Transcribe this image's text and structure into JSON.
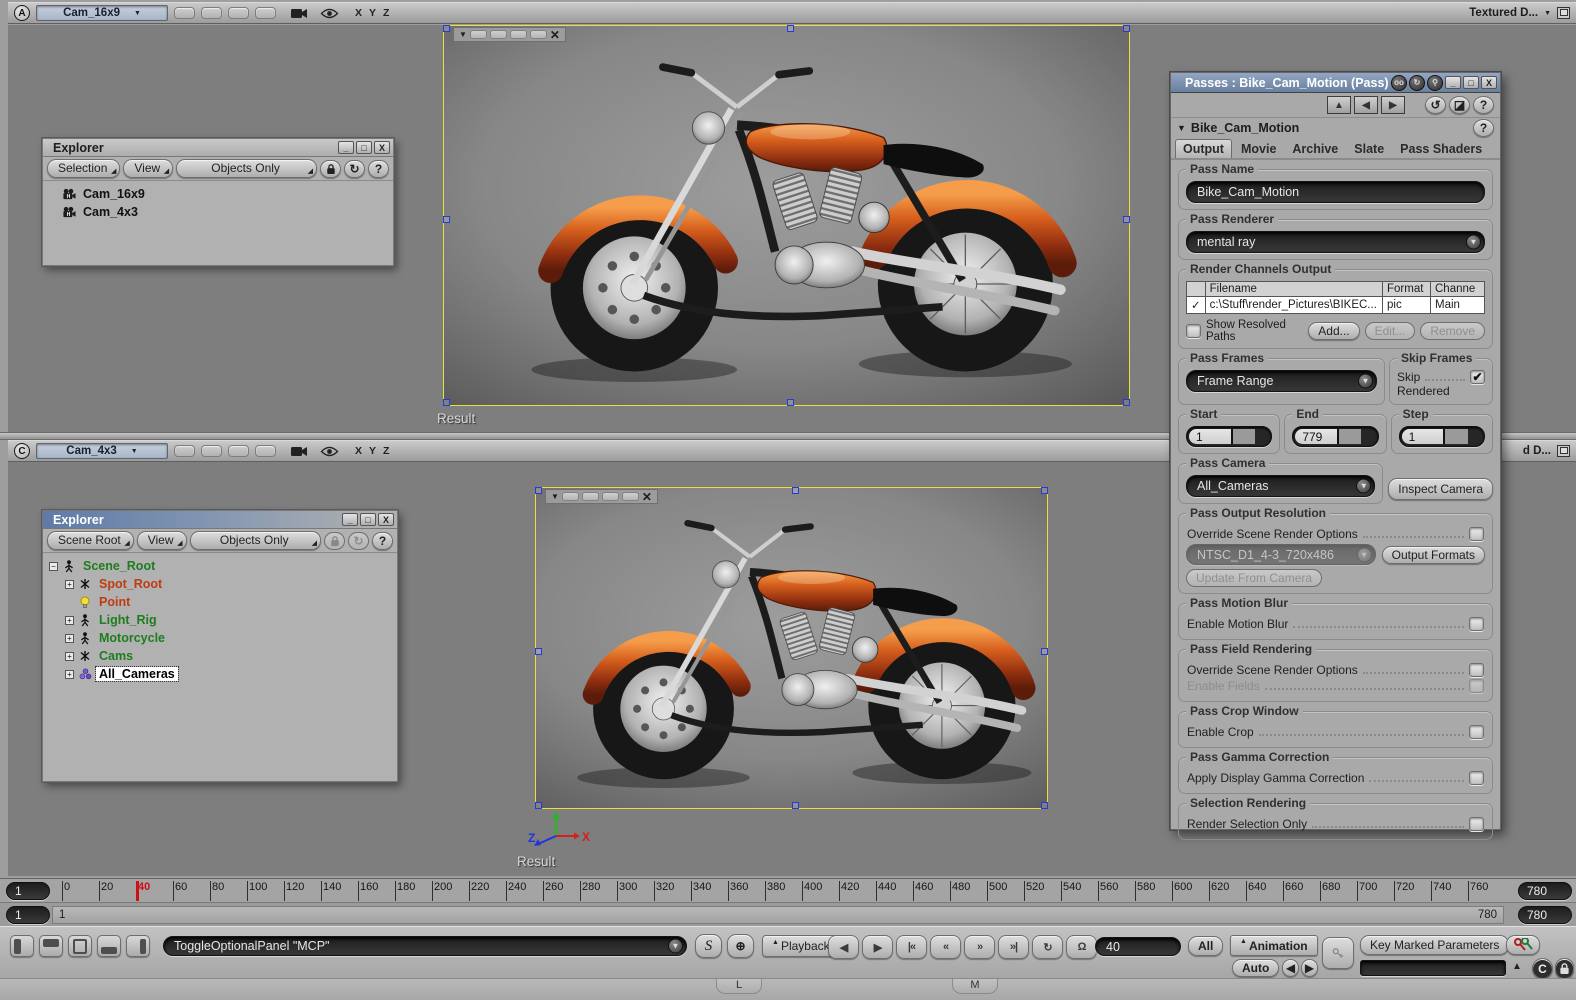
{
  "viewport_a": {
    "letter": "A",
    "camera": "Cam_16x9",
    "axes": [
      "X",
      "Y",
      "Z"
    ],
    "display_mode": "Textured D...",
    "result": "Result"
  },
  "viewport_c": {
    "letter": "C",
    "camera": "Cam_4x3",
    "axes": [
      "X",
      "Y",
      "Z"
    ],
    "display_mode": "d D...",
    "result": "Result",
    "triad": {
      "x": "X",
      "z": "Z"
    }
  },
  "explorer_top": {
    "title": "Explorer",
    "menu": [
      "Selection",
      "View",
      "Objects Only"
    ],
    "help": "?",
    "items": [
      "Cam_16x9",
      "Cam_4x3"
    ]
  },
  "explorer_bottom": {
    "title": "Explorer",
    "menu": [
      "Scene Root",
      "View",
      "Objects Only"
    ],
    "help": "?",
    "items": [
      {
        "label": "Scene_Root",
        "color": "#1e7d1e",
        "icon": "model-person",
        "expander": "-",
        "indent": 0,
        "selected": false
      },
      {
        "label": "Spot_Root",
        "color": "#bf3c12",
        "icon": "null-marker",
        "expander": "+",
        "indent": 1,
        "selected": false
      },
      {
        "label": "Point",
        "color": "#bf3c12",
        "icon": "light-bulb",
        "expander": "",
        "indent": 1,
        "selected": false
      },
      {
        "label": "Light_Rig",
        "color": "#1e7d1e",
        "icon": "model-person",
        "expander": "+",
        "indent": 1,
        "selected": false
      },
      {
        "label": "Motorcycle",
        "color": "#1e7d1e",
        "icon": "model-person",
        "expander": "+",
        "indent": 1,
        "selected": false
      },
      {
        "label": "Cams",
        "color": "#1e7d1e",
        "icon": "null-marker",
        "expander": "+",
        "indent": 1,
        "selected": false
      },
      {
        "label": "All_Cameras",
        "color": "#000000",
        "icon": "camera-group",
        "expander": "+",
        "indent": 1,
        "selected": true
      }
    ]
  },
  "passes": {
    "title": "Passes : Bike_Cam_Motion (Pass)",
    "node": "Bike_Cam_Motion",
    "help": "?",
    "tabs": [
      "Output",
      "Movie",
      "Archive",
      "Slate",
      "Pass Shaders"
    ],
    "active_tab": "Output",
    "pass_name_label": "Pass Name",
    "pass_name": "Bike_Cam_Motion",
    "pass_renderer_label": "Pass Renderer",
    "pass_renderer": "mental ray",
    "channels_label": "Render Channels Output",
    "channels_cols": [
      "Filename",
      "Format",
      "Channe"
    ],
    "channel_row": {
      "checked": "✓",
      "filename": "c:\\Stuff\\render_Pictures\\BIKEC...",
      "format": "pic",
      "channel": "Main"
    },
    "show_resolved": "Show Resolved Paths",
    "add": "Add...",
    "edit": "Edit...",
    "remove": "Remove",
    "pass_frames_label": "Pass Frames",
    "pass_frames": "Frame Range",
    "skip_frames_label": "Skip Frames",
    "skip_word1": "Skip",
    "skip_word2": "Rendered",
    "skip_checked": "✔",
    "start_label": "Start",
    "start": "1",
    "end_label": "End",
    "end": "779",
    "step_label": "Step",
    "step": "1",
    "pass_camera_label": "Pass Camera",
    "pass_camera": "All_Cameras",
    "inspect": "Inspect Camera",
    "res_label": "Pass Output Resolution",
    "override_scene": "Override Scene Render Options",
    "resolution": "NTSC_D1_4-3_720x486",
    "output_formats": "Output Formats",
    "update_from_camera": "Update From Camera",
    "motion_label": "Pass Motion Blur",
    "enable_motion": "Enable Motion Blur",
    "field_label": "Pass Field Rendering",
    "override_scene2": "Override Scene Render Options",
    "enable_fields": "Enable Fields",
    "crop_label": "Pass Crop Window",
    "enable_crop": "Enable Crop",
    "gamma_label": "Pass Gamma Correction",
    "apply_gamma": "Apply Display Gamma Correction",
    "selection_label": "Selection Rendering",
    "render_selection": "Render Selection Only"
  },
  "timeline": {
    "ticks": [
      0,
      20,
      40,
      60,
      80,
      100,
      120,
      140,
      160,
      180,
      200,
      220,
      240,
      260,
      280,
      300,
      320,
      340,
      360,
      380,
      400,
      420,
      440,
      460,
      480,
      500,
      520,
      540,
      560,
      580,
      600,
      620,
      640,
      660,
      680,
      700,
      720,
      740,
      760
    ],
    "playhead": 40,
    "frame_field": "1",
    "end_field_top": "780",
    "range_start_field": "1",
    "range_start": "1",
    "range_end": "780",
    "end_field_bottom": "780"
  },
  "command": {
    "script": "ToggleOptionalPanel \"MCP\"",
    "playback": "Playback",
    "transport": [
      {
        "name": "frame-step-back",
        "g": "◀"
      },
      {
        "name": "frame-step-forward",
        "g": "▶"
      },
      {
        "name": "go-to-start",
        "g": "|«"
      },
      {
        "name": "play-backward",
        "g": "«"
      },
      {
        "name": "play-forward",
        "g": "»"
      },
      {
        "name": "go-to-end",
        "g": "»|"
      },
      {
        "name": "loop",
        "g": "↻"
      },
      {
        "name": "audio-mute",
        "g": "Ω"
      }
    ],
    "frame": "40",
    "all": "All",
    "animation": "Animation",
    "auto": "Auto",
    "key_marked": "Key Marked Parameters"
  },
  "bottom_tabs": [
    "L",
    "M"
  ],
  "colors": {
    "region_border": "#e6e137",
    "handle": "#2b3bcf",
    "playhead": "#cf1010",
    "title_blue": "#7f93b2",
    "tank_orange": "#d65f1d",
    "chrome": "#c9c9c9"
  }
}
